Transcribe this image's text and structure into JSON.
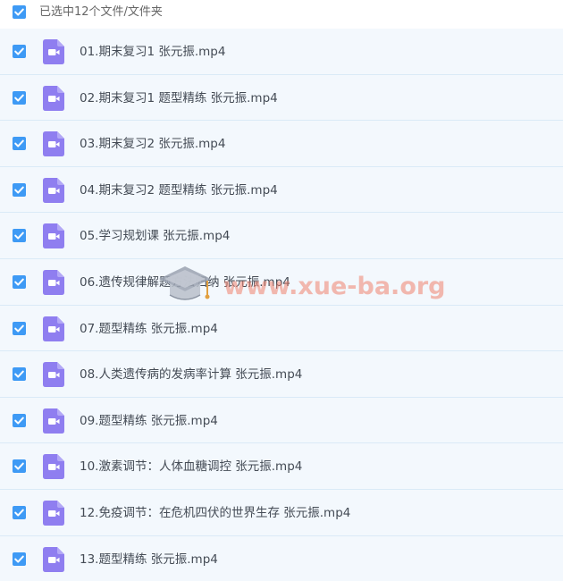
{
  "header": {
    "select_all_checked": true,
    "label": "已选中12个文件/文件夹"
  },
  "file_icon": "video-file-icon",
  "colors": {
    "checkbox": "#3e9af5",
    "file_icon": "#8f7ef0",
    "row_background": "#f3f8fd",
    "row_divider": "#daeaf7",
    "watermark": "#ee826e"
  },
  "files": [
    {
      "name": "01.期末复习1 张元振.mp4",
      "checked": true
    },
    {
      "name": "02.期末复习1 题型精练 张元振.mp4",
      "checked": true
    },
    {
      "name": "03.期末复习2 张元振.mp4",
      "checked": true
    },
    {
      "name": "04.期末复习2 题型精练 张元振.mp4",
      "checked": true
    },
    {
      "name": "05.学习规划课 张元振.mp4",
      "checked": true
    },
    {
      "name": "06.遗传规律解题方法归纳 张元振.mp4",
      "checked": true
    },
    {
      "name": "07.题型精练 张元振.mp4",
      "checked": true
    },
    {
      "name": "08.人类遗传病的发病率计算 张元振.mp4",
      "checked": true
    },
    {
      "name": "09.题型精练 张元振.mp4",
      "checked": true
    },
    {
      "name": "10.激素调节：人体血糖调控 张元振.mp4",
      "checked": true
    },
    {
      "name": "12.免疫调节：在危机四伏的世界生存 张元振.mp4",
      "checked": true
    },
    {
      "name": "13.题型精练 张元振.mp4",
      "checked": true
    }
  ],
  "watermark": {
    "text": "www.xue-ba.org",
    "logo": "mortarboard-logo"
  }
}
